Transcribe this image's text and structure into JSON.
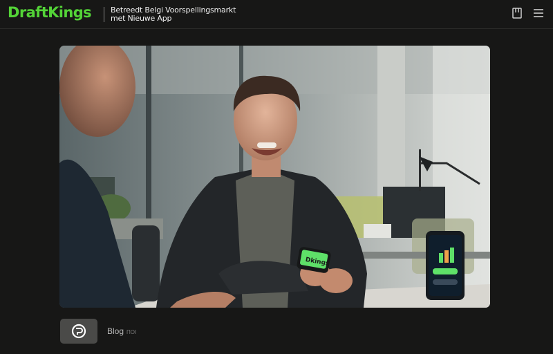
{
  "header": {
    "brand": "DraftKings",
    "headline_line1": "Betreedt Belgi Voorspellingsmarkt",
    "headline_line2": "met Nieuwe App",
    "icons": [
      "bookmark-icon",
      "menu-icon"
    ]
  },
  "hero": {
    "phone_logo": "Dkings",
    "colors": {
      "accent": "#53d337",
      "phone_button": "#5ee068"
    }
  },
  "footer": {
    "label": "Blog",
    "suffix": "ПОI",
    "icon": "brand-logo-icon"
  },
  "colors": {
    "background": "#171716",
    "brand": "#53d337",
    "text": "#f2f2f2"
  }
}
